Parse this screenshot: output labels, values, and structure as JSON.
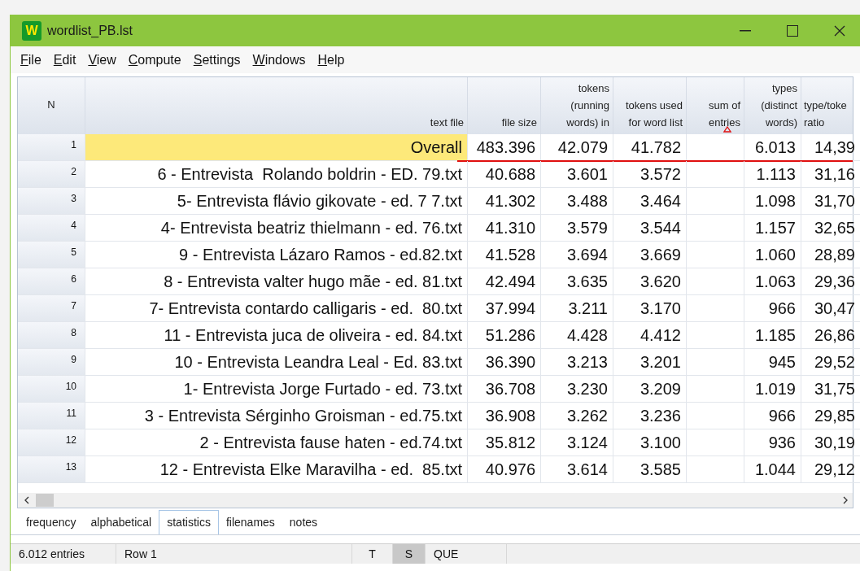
{
  "window": {
    "title": "wordlist_PB.lst",
    "logo": "W"
  },
  "menu": [
    "File",
    "Edit",
    "View",
    "Compute",
    "Settings",
    "Windows",
    "Help"
  ],
  "table": {
    "columns": [
      {
        "label": "N",
        "sorted": false
      },
      {
        "label": "text file",
        "sorted": false
      },
      {
        "label": "file size",
        "sorted": false
      },
      {
        "label": "tokens (running words) in",
        "sorted": false
      },
      {
        "label": "tokens used for word list",
        "sorted": false
      },
      {
        "label": "sum of entries",
        "sorted": true
      },
      {
        "label": "types (distinct words)",
        "sorted": false
      },
      {
        "label": "type/toke ratio",
        "sorted": false
      }
    ],
    "rows": [
      {
        "cells": [
          "1",
          "Overall",
          "483.396",
          "42.079",
          "41.782",
          "",
          "6.013",
          "14,39"
        ],
        "selected": true
      },
      {
        "cells": [
          "2",
          "6 - Entrevista  Rolando boldrin - ED. 79.txt",
          "40.688",
          "3.601",
          "3.572",
          "",
          "1.113",
          "31,16"
        ],
        "selected": false
      },
      {
        "cells": [
          "3",
          "5- Entrevista flávio gikovate - ed. 7 7.txt",
          "41.302",
          "3.488",
          "3.464",
          "",
          "1.098",
          "31,70"
        ],
        "selected": false
      },
      {
        "cells": [
          "4",
          "4- Entrevista beatriz thielmann - ed. 76.txt",
          "41.310",
          "3.579",
          "3.544",
          "",
          "1.157",
          "32,65"
        ],
        "selected": false
      },
      {
        "cells": [
          "5",
          "9 - Entrevista Lázaro Ramos - ed.82.txt",
          "41.528",
          "3.694",
          "3.669",
          "",
          "1.060",
          "28,89"
        ],
        "selected": false
      },
      {
        "cells": [
          "6",
          "8 - Entrevista valter hugo mãe - ed. 81.txt",
          "42.494",
          "3.635",
          "3.620",
          "",
          "1.063",
          "29,36"
        ],
        "selected": false
      },
      {
        "cells": [
          "7",
          "7- Entrevista contardo calligaris - ed.  80.txt",
          "37.994",
          "3.211",
          "3.170",
          "",
          "966",
          "30,47"
        ],
        "selected": false
      },
      {
        "cells": [
          "8",
          "11 - Entrevista juca de oliveira - ed. 84.txt",
          "51.286",
          "4.428",
          "4.412",
          "",
          "1.185",
          "26,86"
        ],
        "selected": false
      },
      {
        "cells": [
          "9",
          "10 - Entrevista Leandra Leal - Ed. 83.txt",
          "36.390",
          "3.213",
          "3.201",
          "",
          "945",
          "29,52"
        ],
        "selected": false
      },
      {
        "cells": [
          "10",
          "1- Entrevista Jorge Furtado - ed. 73.txt",
          "36.708",
          "3.230",
          "3.209",
          "",
          "1.019",
          "31,75"
        ],
        "selected": false
      },
      {
        "cells": [
          "11",
          "3 - Entrevista Sérginho Groisman - ed.75.txt",
          "36.908",
          "3.262",
          "3.236",
          "",
          "966",
          "29,85"
        ],
        "selected": false
      },
      {
        "cells": [
          "12",
          "2 - Entrevista fause haten - ed.74.txt",
          "35.812",
          "3.124",
          "3.100",
          "",
          "936",
          "30,19"
        ],
        "selected": false
      },
      {
        "cells": [
          "13",
          "12 - Entrevista Elke Maravilha - ed.  85.txt",
          "40.976",
          "3.614",
          "3.585",
          "",
          "1.044",
          "29,12"
        ],
        "selected": false
      }
    ]
  },
  "tabs": [
    {
      "label": "frequency",
      "selected": false
    },
    {
      "label": "alphabetical",
      "selected": false
    },
    {
      "label": "statistics",
      "selected": true
    },
    {
      "label": "filenames",
      "selected": false
    },
    {
      "label": "notes",
      "selected": false
    }
  ],
  "status_bar": [
    {
      "text": "6.012 entries",
      "pressed": false
    },
    {
      "text": "Row 1",
      "pressed": false
    },
    {
      "text": "T",
      "pressed": false
    },
    {
      "text": "S",
      "pressed": true
    },
    {
      "text": "QUE",
      "pressed": false
    }
  ]
}
